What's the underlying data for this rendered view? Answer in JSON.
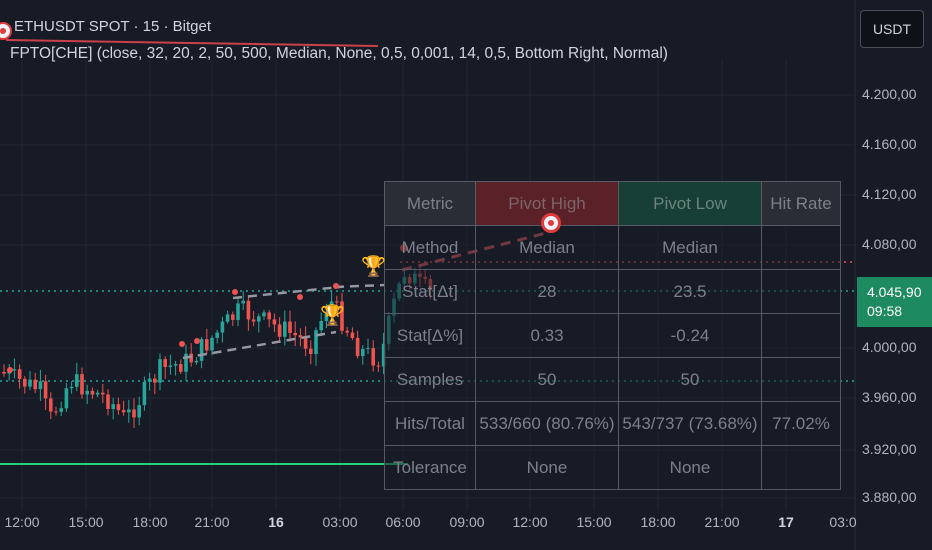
{
  "header": {
    "symbol_line": "ETHUSDT SPOT · 15 · Bitget",
    "indicator_line": "FPTO[CHE] (close, 32, 20, 2, 50, 500, Median, None, 0,5, 0,001, 14, 0,5, Bottom Right, Normal)"
  },
  "currency_button": "USDT",
  "price_axis": {
    "labels": [
      "4.200,00",
      "4.160,00",
      "4.120,00",
      "4.080,00",
      "4.000,00",
      "3.960,00",
      "3.920,00",
      "3.880,00"
    ],
    "current_price": "4.045,90",
    "countdown": "09:58"
  },
  "time_axis": {
    "labels": [
      "12:00",
      "15:00",
      "18:00",
      "21:00",
      "16",
      "03:00",
      "06:00",
      "09:00",
      "12:00",
      "15:00",
      "18:00",
      "21:00",
      "17",
      "03:0"
    ]
  },
  "stats_table": {
    "headers": [
      "Metric",
      "Pivot High",
      "Pivot Low",
      "Hit Rate"
    ],
    "rows": [
      [
        "Method",
        "Median",
        "Median",
        ""
      ],
      [
        "Stat[Δt]",
        "28",
        "23.5",
        ""
      ],
      [
        "Stat[Δ%]",
        "0.33",
        "-0.24",
        ""
      ],
      [
        "Samples",
        "50",
        "50",
        ""
      ],
      [
        "Hits/Total",
        "533/660 (80.76%)",
        "543/737 (73.68%)",
        "77.02%"
      ],
      [
        "Tolerance",
        "None",
        "None",
        ""
      ]
    ]
  },
  "colors": {
    "background": "#171b26",
    "up": "#26a69a",
    "down": "#ef5350",
    "price_tag": "#1e8a60"
  }
}
